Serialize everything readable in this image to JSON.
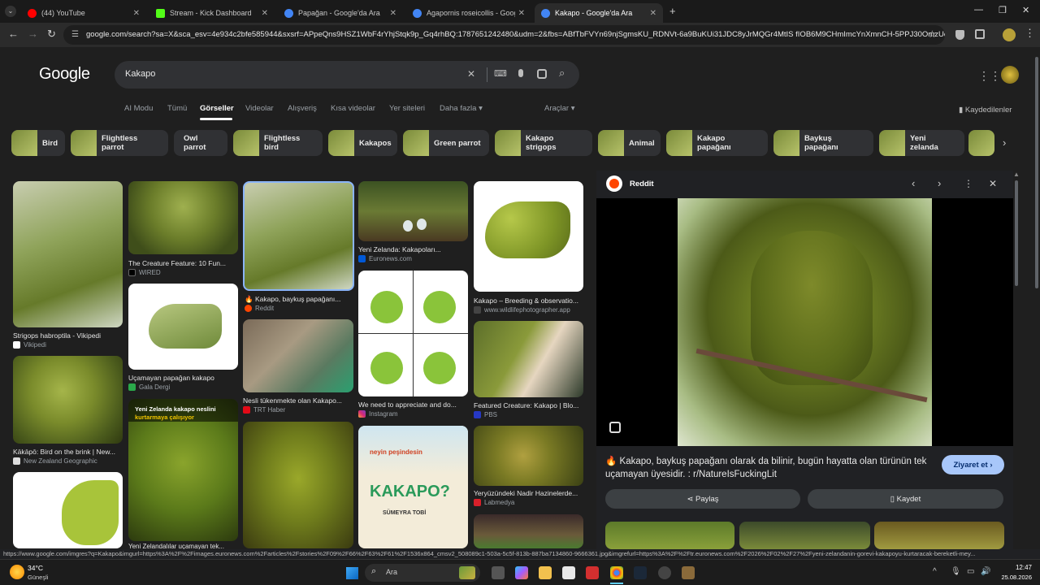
{
  "browser": {
    "tabs": [
      {
        "title": "(44) YouTube",
        "color": "#ff0000"
      },
      {
        "title": "Stream - Kick Dashboard",
        "color": "#53fc18"
      },
      {
        "title": "Papağan - Google'da Ara",
        "color": "#4285f4"
      },
      {
        "title": "Agapornis roseicollis - Google",
        "color": "#4285f4"
      },
      {
        "title": "Kakapo - Google'da Ara",
        "color": "#4285f4"
      }
    ],
    "url": "google.com/search?sa=X&sca_esv=4e934c2bfe585944&sxsrf=APpeQns9HSZ1WbF4rYhjStqk9p_Gq4rhBQ:1787651242480&udm=2&fbs=ABfTbFVYn69njSgmsKU_RDNVt-6a9BuKUi31JDC8yJrMQGr4MtIS fIOB6M9CHmImcYnXmnCH-5PPJ30OmzUoVxk..."
  },
  "google": {
    "logo": "Google",
    "query": "Kakapo",
    "nav_tabs": [
      "AI Modu",
      "Tümü",
      "Görseller",
      "Videolar",
      "Alışveriş",
      "Kısa videolar",
      "Yer siteleri",
      "Daha fazla"
    ],
    "tools": "Araçlar",
    "saved": "Kaydedilenler"
  },
  "chips": [
    "Bird",
    "Flightless parrot",
    "Owl parrot",
    "Flightless bird",
    "Kakapos",
    "Green parrot",
    "Kakapo strigops",
    "Animal",
    "Kakapo papağanı",
    "Baykuş papağanı",
    "Yeni zelanda"
  ],
  "results": [
    {
      "caption": "Strigops habroptila - Vikipedi",
      "source": "Vikipedi"
    },
    {
      "caption": "The Creature Feature: 10 Fun...",
      "source": "WIRED"
    },
    {
      "caption": "Kakapo, baykuş papağanı...",
      "source": "Reddit"
    },
    {
      "caption": "Yeni Zelanda: Kakapoları...",
      "source": "Euronews.com"
    },
    {
      "caption": "Kakapo – Breeding & observatio...",
      "source": "www.wildlifephotographer.app"
    },
    {
      "caption": "Uçamayan papağan kakapo",
      "source": "Gala Dergi"
    },
    {
      "caption": "Nesli tükenmekte olan Kakapo...",
      "source": "TRT Haber"
    },
    {
      "caption": "We need to appreciate and do...",
      "source": "Instagram"
    },
    {
      "caption": "Featured Creature: Kakapo | Blo...",
      "source": "PBS"
    },
    {
      "caption": "Kākāpō: Bird on the brink | New...",
      "source": "New Zealand Geographic"
    },
    {
      "caption": "Yeryüzündeki Nadir Hazinelerde...",
      "source": "Labmedya"
    },
    {
      "caption": "Yeni Zelandalılar uçamayan tek...",
      "source": ""
    }
  ],
  "overlay_texts": {
    "yeni_zelanda": "Yeni Zelanda kakapo neslini",
    "kurtarmaya": "kurtarmaya çalışıyor",
    "book_top": "neyin peşindesin",
    "book_title": "KAKAPO?",
    "book_author": "SÜMEYRA TOBİ"
  },
  "panel": {
    "site": "Reddit",
    "title": "Kakapo, baykuş papağanı olarak da bilinir, bugün hayatta olan türünün tek uçamayan üyesidir. : r/NatureIsFuckingLit",
    "visit": "Ziyaret et",
    "share": "Paylaş",
    "save": "Kaydet"
  },
  "status_url": "https://www.google.com/imgres?q=Kakapo&imgurl=https%3A%2F%2Fimages.euronews.com%2Farticles%2Fstories%2F09%2F66%2F63%2F61%2F1536x864_cmsv2_508089c1-503a-5c5f-813b-887ba7134860-9666361.jpg&imgrefurl=https%3A%2F%2Ftr.euronews.com%2F2026%2F02%2F27%2Fyeni-zelandanin-gorevi-kakapoyu-kurtaracak-bereketli-mey...",
  "taskbar": {
    "weather_temp": "34°C",
    "weather_desc": "Güneşli",
    "search": "Ara",
    "time": "12:47",
    "date": "25.08.2026"
  }
}
